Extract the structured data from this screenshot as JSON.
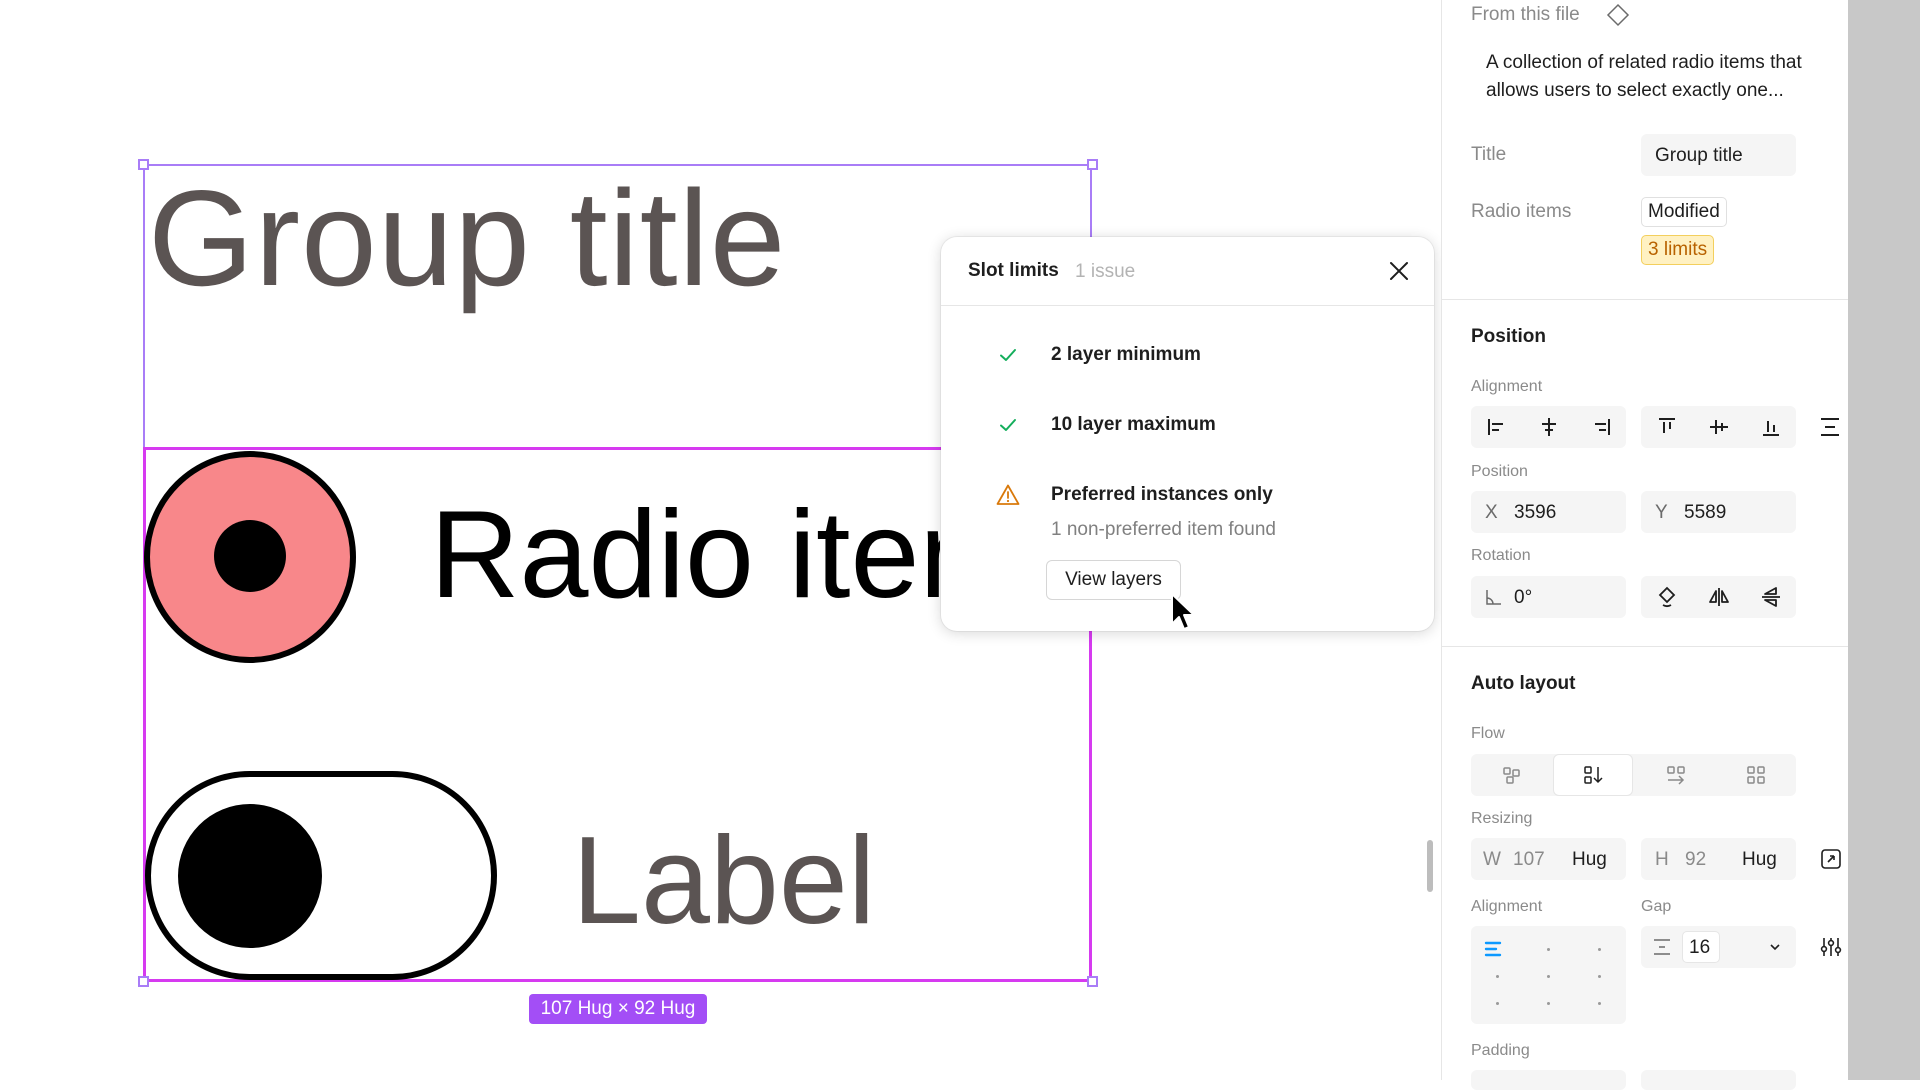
{
  "canvas": {
    "group_title": "Group title",
    "radio_label": "Radio item",
    "toggle_label": "Label",
    "size_badge": "107 Hug × 92 Hug",
    "colors": {
      "selection": "#a97df7",
      "slot": "#d63af0",
      "radio_fill": "#f8878a",
      "badge": "#a34ef6"
    }
  },
  "popover": {
    "title": "Slot limits",
    "issue_count": "1 issue",
    "rules": [
      {
        "status": "pass",
        "text": "2 layer minimum"
      },
      {
        "status": "pass",
        "text": "10 layer maximum"
      },
      {
        "status": "warning",
        "text": "Preferred instances only",
        "detail": "1 non-preferred item found"
      }
    ],
    "view_button": "View layers",
    "colors": {
      "check": "#14ae5c",
      "warning": "#d9790b"
    }
  },
  "panel": {
    "source_label": "From this file",
    "description_line1": "A collection of related radio items that",
    "description_line2": "allows users to select exactly one...",
    "title_label": "Title",
    "title_value": "Group title",
    "radio_items_label": "Radio items",
    "modified_chip": "Modified",
    "limits_chip": "3 limits",
    "position": {
      "section": "Position",
      "alignment_label": "Alignment",
      "position_label": "Position",
      "x_label": "X",
      "x_value": "3596",
      "y_label": "Y",
      "y_value": "5589",
      "rotation_label": "Rotation",
      "rotation_value": "0°"
    },
    "auto_layout": {
      "section": "Auto layout",
      "flow_label": "Flow",
      "resizing_label": "Resizing",
      "w_label": "W",
      "w_value": "107",
      "w_mode": "Hug",
      "h_label": "H",
      "h_value": "92",
      "h_mode": "Hug",
      "alignment_label": "Alignment",
      "gap_label": "Gap",
      "gap_value": "16",
      "padding_label": "Padding"
    }
  }
}
